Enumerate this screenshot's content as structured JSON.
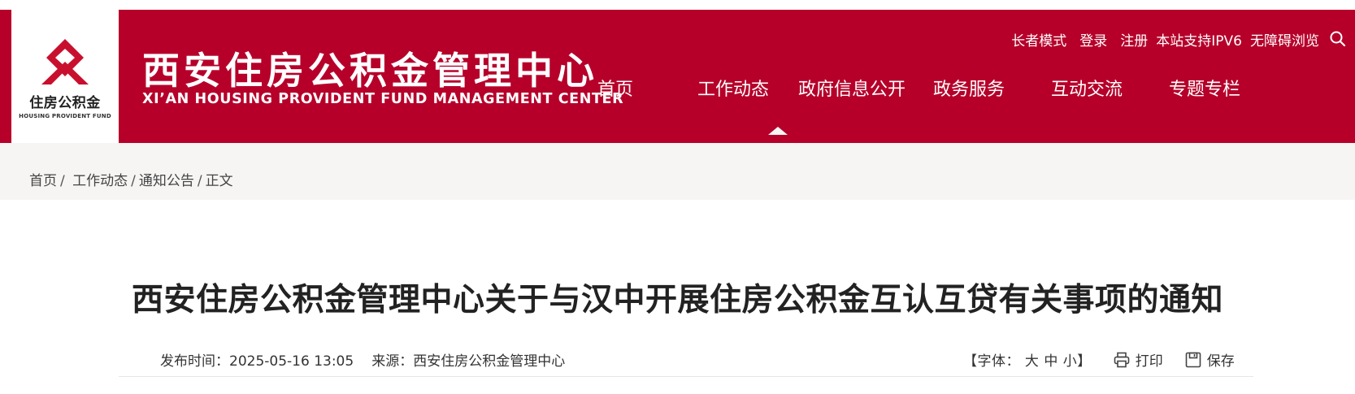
{
  "brand": {
    "logo_cn": "住房公积金",
    "logo_en": "HOUSING PROVIDENT FUND",
    "title": "西安住房公积金管理中心",
    "subtitle": "XI’AN HOUSING PROVIDENT FUND MANAGEMENT CENTER",
    "color": "#b6002a"
  },
  "utility": {
    "items": [
      "长者模式",
      "登录",
      "注册",
      "本站支持IPV6",
      "无障碍浏览"
    ],
    "search_icon": "search-icon"
  },
  "nav": {
    "items": [
      "首页",
      "工作动态",
      "政府信息公开",
      "政务服务",
      "互动交流",
      "专题专栏"
    ],
    "active_index": 1
  },
  "breadcrumb": {
    "items": [
      "首页",
      "工作动态",
      "通知公告",
      "正文"
    ],
    "separator": "/"
  },
  "article": {
    "title": "西安住房公积金管理中心关于与汉中开展住房公积金互认互贷有关事项的通知",
    "publish_label": "发布时间：",
    "publish_time": "2025-05-16 13:05",
    "source_label": "来源：",
    "source": "西安住房公积金管理中心"
  },
  "tools": {
    "font_open": "【字体：",
    "font_large": "大",
    "font_medium": "中",
    "font_small": "小",
    "font_close": "】",
    "print_label": "打印",
    "save_label": "保存"
  }
}
